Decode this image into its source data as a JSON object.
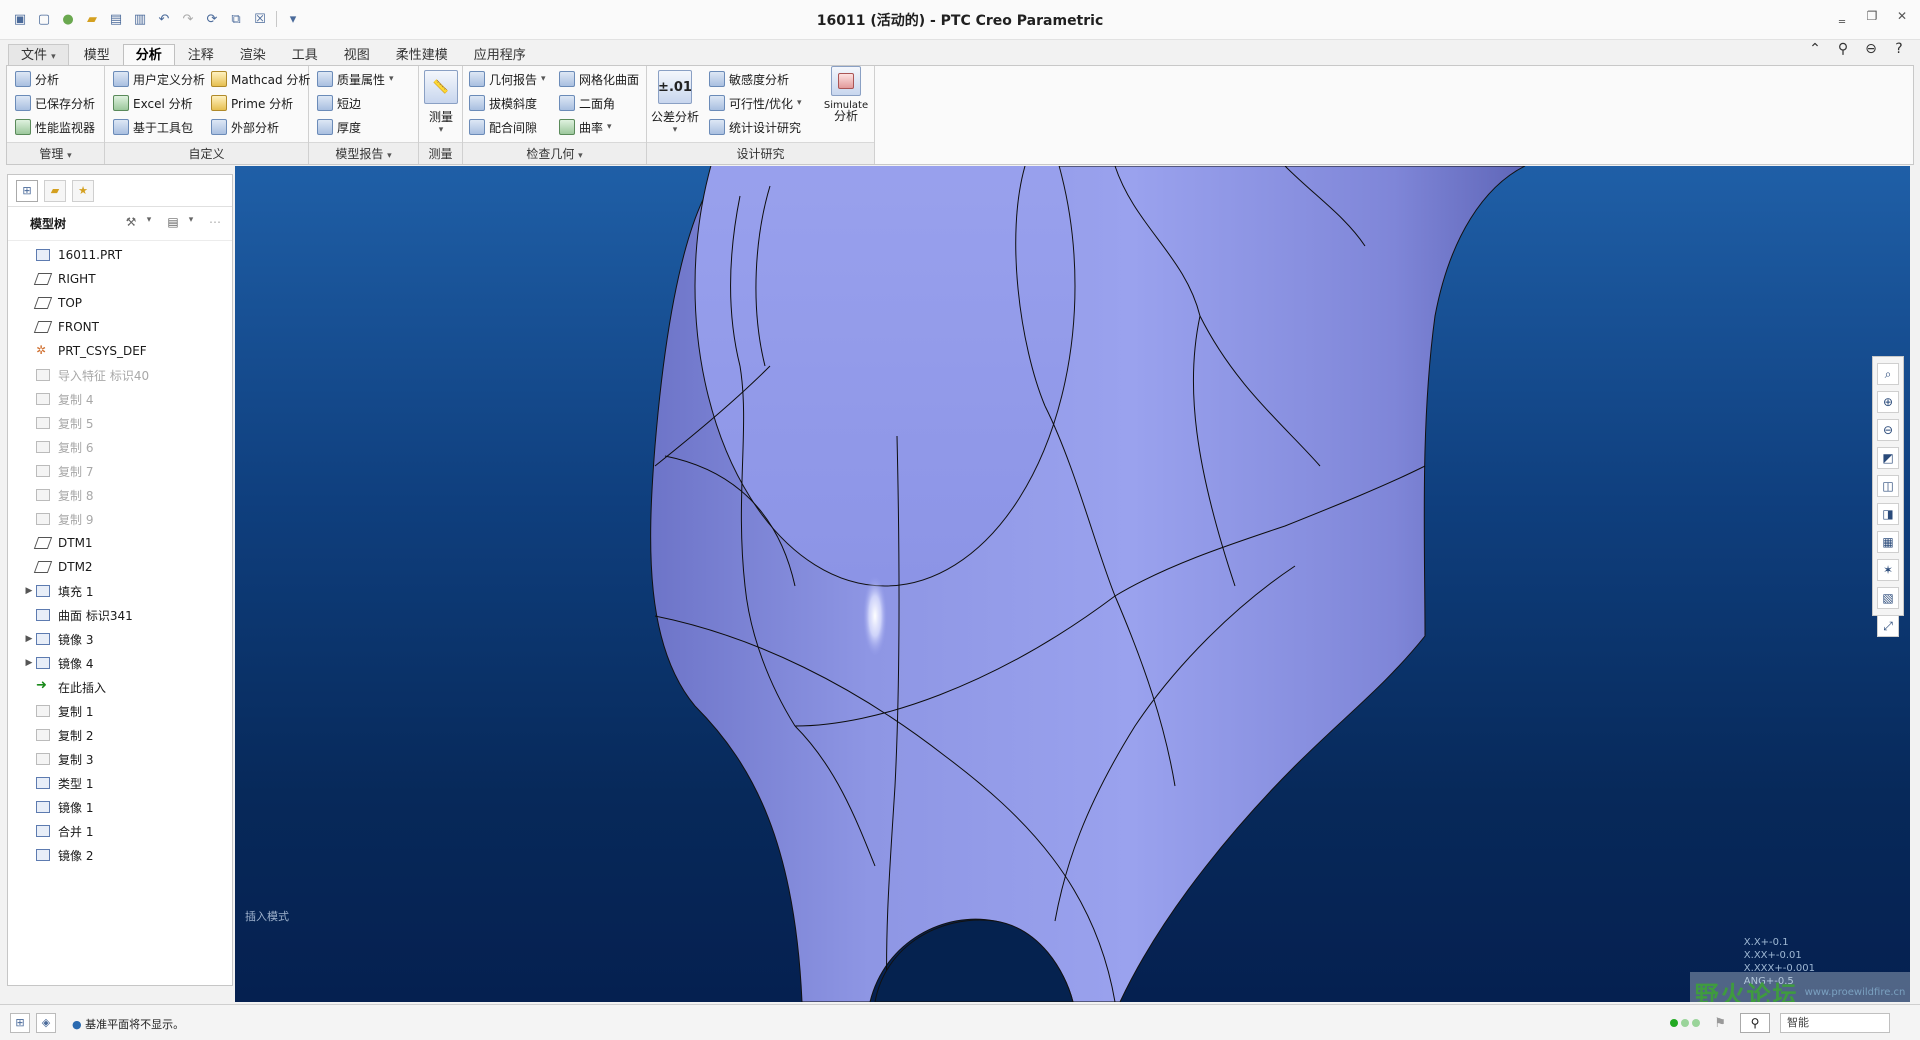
{
  "window": {
    "title": "16011 (活动的) - PTC Creo Parametric"
  },
  "qat_icons": [
    "app-icon",
    "new-icon",
    "open-sphere-icon",
    "open-folder-icon",
    "save-icon",
    "save-as-icon",
    "undo-icon",
    "redo-icon",
    "regenerate-icon",
    "window-switch-icon",
    "close-window-icon",
    "customize-icon"
  ],
  "tabs": [
    "文件",
    "模型",
    "分析",
    "注释",
    "渲染",
    "工具",
    "视图",
    "柔性建模",
    "应用程序"
  ],
  "ribbon": {
    "manage": {
      "items": [
        "分析",
        "已保存分析",
        "性能监视器"
      ],
      "label": "管理"
    },
    "custom": {
      "items": [
        "用户定义分析",
        "Excel 分析",
        "基于工具包",
        "Mathcad 分析",
        "Prime 分析",
        "外部分析"
      ],
      "label": "自定义"
    },
    "model_report": {
      "items": [
        "质量属性",
        "短边",
        "厚度"
      ],
      "label": "模型报告"
    },
    "measure": {
      "button": "测量",
      "label": "测量"
    },
    "inspect": {
      "items": [
        "几何报告",
        "拔模斜度",
        "配合间隙",
        "网格化曲面",
        "二面角",
        "曲率"
      ],
      "label": "检查几何"
    },
    "design_study": {
      "tolerance_icon": "±.01",
      "tolerance_label": "公差分析",
      "items": [
        "敏感度分析",
        "可行性/优化",
        "统计设计研究"
      ],
      "simulate_top": "Simulate",
      "simulate_bottom": "分析",
      "label": "设计研究"
    }
  },
  "sidebar": {
    "tree_title": "模型树",
    "items": [
      {
        "label": "16011.PRT",
        "icon": "part",
        "dim": false,
        "exp": ""
      },
      {
        "label": "RIGHT",
        "icon": "plane",
        "dim": false,
        "exp": ""
      },
      {
        "label": "TOP",
        "icon": "plane",
        "dim": false,
        "exp": ""
      },
      {
        "label": "FRONT",
        "icon": "plane",
        "dim": false,
        "exp": ""
      },
      {
        "label": "PRT_CSYS_DEF",
        "icon": "csys",
        "dim": false,
        "exp": ""
      },
      {
        "label": "导入特征 标识40",
        "icon": "import",
        "dim": true,
        "exp": ""
      },
      {
        "label": "复制 4",
        "icon": "copy",
        "dim": true,
        "exp": ""
      },
      {
        "label": "复制 5",
        "icon": "copy",
        "dim": true,
        "exp": ""
      },
      {
        "label": "复制 6",
        "icon": "copy",
        "dim": true,
        "exp": ""
      },
      {
        "label": "复制 7",
        "icon": "copy",
        "dim": true,
        "exp": ""
      },
      {
        "label": "复制 8",
        "icon": "copy",
        "dim": true,
        "exp": ""
      },
      {
        "label": "复制 9",
        "icon": "copy",
        "dim": true,
        "exp": ""
      },
      {
        "label": "DTM1",
        "icon": "plane",
        "dim": false,
        "exp": ""
      },
      {
        "label": "DTM2",
        "icon": "plane",
        "dim": false,
        "exp": ""
      },
      {
        "label": "填充 1",
        "icon": "fill",
        "dim": false,
        "exp": "▶"
      },
      {
        "label": "曲面 标识341",
        "icon": "surface",
        "dim": false,
        "exp": ""
      },
      {
        "label": "镜像 3",
        "icon": "mirror",
        "dim": false,
        "exp": "▶"
      },
      {
        "label": "镜像 4",
        "icon": "mirror",
        "dim": false,
        "exp": "▶"
      },
      {
        "label": "在此插入",
        "icon": "insert",
        "dim": false,
        "exp": ""
      },
      {
        "label": "复制 1",
        "icon": "copy",
        "dim": false,
        "exp": ""
      },
      {
        "label": "复制 2",
        "icon": "copy",
        "dim": false,
        "exp": ""
      },
      {
        "label": "复制 3",
        "icon": "copy",
        "dim": false,
        "exp": ""
      },
      {
        "label": "类型 1",
        "icon": "type",
        "dim": false,
        "exp": ""
      },
      {
        "label": "镜像 1",
        "icon": "mirror",
        "dim": false,
        "exp": ""
      },
      {
        "label": "合并 1",
        "icon": "merge",
        "dim": false,
        "exp": ""
      },
      {
        "label": "镜像 2",
        "icon": "mirror",
        "dim": false,
        "exp": ""
      }
    ]
  },
  "viewport": {
    "mode": "插入模式",
    "tolerance": [
      "X.X+-0.1",
      "X.XX+-0.01",
      "X.XXX+-0.001",
      "ANG+-0.5"
    ],
    "watermark_big": "野火论坛",
    "watermark_url": "www.proewildfire.cn",
    "surface_color": "#8f98e6"
  },
  "status": {
    "message": "基准平面将不显示。",
    "filter": "智能"
  }
}
